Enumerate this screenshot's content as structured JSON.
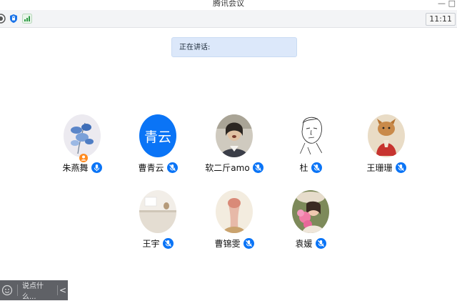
{
  "window": {
    "title": "腾讯会议",
    "minimize_glyph": "—",
    "maximize_glyph": "□"
  },
  "toolbar": {
    "icons": [
      "record-icon",
      "security-shield-icon",
      "signal-bars-icon"
    ],
    "clock": "11:11"
  },
  "speaking": {
    "label": "正在讲话:"
  },
  "participants": [
    {
      "name": "朱燕舞",
      "avatar": "photo-blue-flowers",
      "host": true,
      "mic": "active"
    },
    {
      "name": "曹青云",
      "avatar_text": "青云",
      "avatar": "text",
      "mic": "muted"
    },
    {
      "name": "软二斤amo",
      "avatar": "photo-person",
      "mic": "muted"
    },
    {
      "name": "杜",
      "avatar": "photo-sketch-face",
      "mic": "muted"
    },
    {
      "name": "王珊珊",
      "avatar": "photo-cat",
      "mic": "muted"
    },
    {
      "name": "王宇",
      "avatar": "photo-room",
      "mic": "muted"
    },
    {
      "name": "曹锦雯",
      "avatar": "photo-holding-flower",
      "mic": "muted"
    },
    {
      "name": "袁媛",
      "avatar": "photo-pink-flowers",
      "mic": "muted"
    }
  ],
  "chat": {
    "placeholder": "说点什么...",
    "collapse_glyph": "<"
  },
  "colors": {
    "accent": "#0a74f6",
    "speaking_bg": "#dce8fa",
    "chatbar_bg": "#5f6166"
  }
}
